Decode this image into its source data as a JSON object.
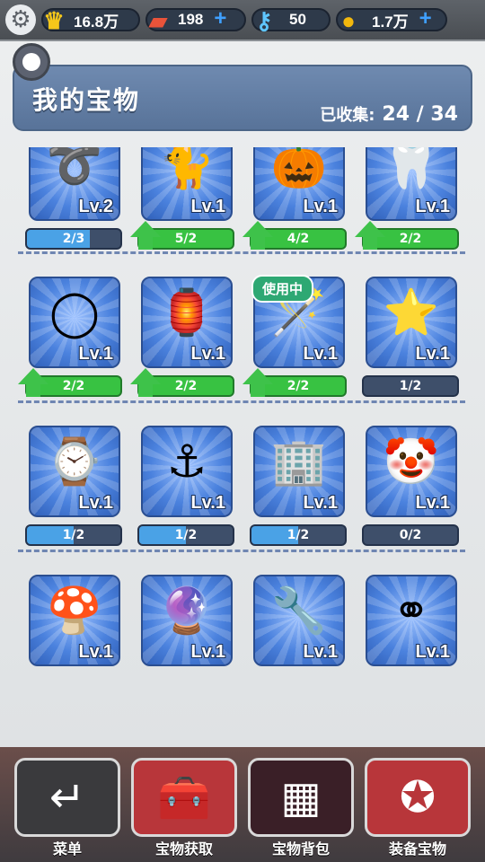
{
  "topbar": {
    "gold": "16.8万",
    "boards": "198",
    "keys": "50",
    "coins": "1.7万",
    "plus": "+",
    "gear_glyph": "⚙",
    "crown_glyph": "♛",
    "board_glyph": "▰",
    "key_glyph": "⚷",
    "coin_glyph": "●"
  },
  "panel": {
    "title": "我的宝物",
    "collected_label": "已收集:",
    "collected_value": "24 / 34"
  },
  "rows": [
    [
      {
        "icon": "rope-knot-icon",
        "glyph": "➰",
        "level": "Lv.2",
        "progress": "2/3",
        "upgradable": false,
        "fraction": 0.67
      },
      {
        "icon": "cat-statue-icon",
        "glyph": "🐈",
        "level": "Lv.1",
        "progress": "5/2",
        "upgradable": true,
        "fraction": 1
      },
      {
        "icon": "pumpkin-icon",
        "glyph": "🎃",
        "level": "Lv.1",
        "progress": "4/2",
        "upgradable": true,
        "fraction": 1
      },
      {
        "icon": "tooth-necklace-icon",
        "glyph": "🦷",
        "level": "Lv.1",
        "progress": "2/2",
        "upgradable": true,
        "fraction": 1
      }
    ],
    [
      {
        "icon": "gold-ring-icon",
        "glyph": "◯",
        "level": "Lv.1",
        "progress": "2/2",
        "upgradable": true,
        "fraction": 1
      },
      {
        "icon": "lantern-icon",
        "glyph": "🏮",
        "level": "Lv.1",
        "progress": "2/2",
        "upgradable": true,
        "fraction": 1
      },
      {
        "icon": "staff-icon",
        "glyph": "🪄",
        "level": "Lv.1",
        "progress": "2/2",
        "upgradable": true,
        "fraction": 1,
        "in_use": "使用中"
      },
      {
        "icon": "star-necklace-icon",
        "glyph": "⭐",
        "level": "Lv.1",
        "progress": "1/2",
        "upgradable": false,
        "fraction": 0
      }
    ],
    [
      {
        "icon": "digital-watch-icon",
        "glyph": "⌚",
        "level": "Lv.1",
        "progress": "1/2",
        "upgradable": false,
        "fraction": 0.5
      },
      {
        "icon": "anchor-icon",
        "glyph": "⚓",
        "level": "Lv.1",
        "progress": "1/2",
        "upgradable": false,
        "fraction": 0.5
      },
      {
        "icon": "skyscraper-icon",
        "glyph": "🏢",
        "level": "Lv.1",
        "progress": "1/2",
        "upgradable": false,
        "fraction": 0.5
      },
      {
        "icon": "clown-mask-icon",
        "glyph": "🤡",
        "level": "Lv.1",
        "progress": "0/2",
        "upgradable": false,
        "fraction": 0
      }
    ],
    [
      {
        "icon": "mushroom-icon",
        "glyph": "🍄",
        "level": "Lv.1",
        "progress": "",
        "upgradable": false,
        "fraction": 0
      },
      {
        "icon": "purple-orb-icon",
        "glyph": "🔮",
        "level": "Lv.1",
        "progress": "",
        "upgradable": false,
        "fraction": 0
      },
      {
        "icon": "wind-up-key-icon",
        "glyph": "🔧",
        "level": "Lv.1",
        "progress": "",
        "upgradable": false,
        "fraction": 0
      },
      {
        "icon": "two-rings-icon",
        "glyph": "⚭",
        "level": "Lv.1",
        "progress": "",
        "upgradable": false,
        "fraction": 0
      }
    ]
  ],
  "nav": [
    {
      "name": "menu",
      "label": "菜单",
      "icon": "return-arrow-icon",
      "glyph": "↵"
    },
    {
      "name": "obtain",
      "label": "宝物获取",
      "icon": "treasure-chest-icon",
      "glyph": "🧰"
    },
    {
      "name": "bag",
      "label": "宝物背包",
      "icon": "grid-check-icon",
      "glyph": "▦"
    },
    {
      "name": "equip",
      "label": "装备宝物",
      "icon": "equip-star-icon",
      "glyph": "✪"
    }
  ]
}
